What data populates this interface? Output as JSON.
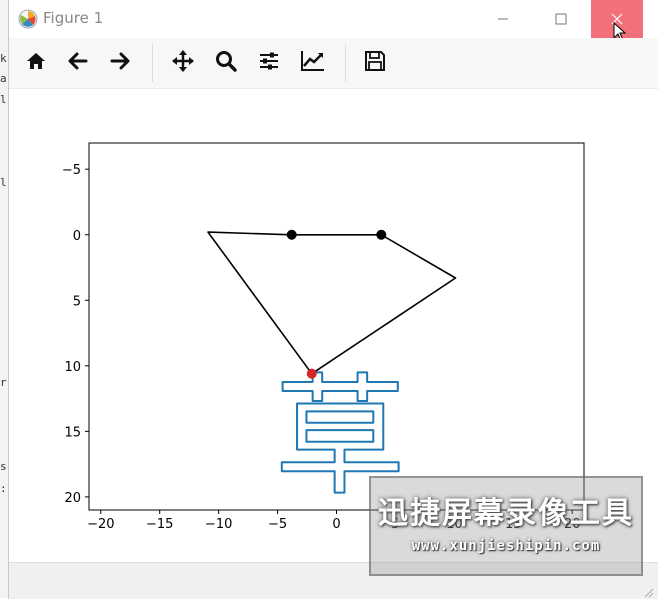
{
  "window": {
    "title": "Figure 1"
  },
  "titlebar_icons": {
    "minimize": "minimize-icon",
    "maximize": "maximize-icon",
    "close": "close-icon",
    "close_color": "#f1707a"
  },
  "toolbar": {
    "buttons": [
      {
        "name": "home-button",
        "icon": "home-icon"
      },
      {
        "name": "back-button",
        "icon": "arrow-left-icon"
      },
      {
        "name": "forward-button",
        "icon": "arrow-right-icon"
      },
      {
        "name": "pan-button",
        "icon": "move-icon"
      },
      {
        "name": "zoom-button",
        "icon": "zoom-icon"
      },
      {
        "name": "configure-subplots-button",
        "icon": "sliders-icon"
      },
      {
        "name": "edit-axis-button",
        "icon": "chart-line-icon"
      },
      {
        "name": "save-button",
        "icon": "save-icon"
      }
    ]
  },
  "background_text": [
    "k",
    "a",
    "l",
    "",
    "",
    "",
    "l",
    "",
    "r",
    "",
    "",
    "",
    "",
    "",
    "r",
    "",
    "",
    "",
    "s",
    ":"
  ],
  "watermark": {
    "title": "迅捷屏幕录像工具",
    "url": "www.xunjieshipin.com"
  },
  "chart_data": {
    "type": "line",
    "title": "",
    "xlabel": "",
    "ylabel": "",
    "xlim": [
      -21,
      21
    ],
    "ylim": [
      21,
      -7
    ],
    "y_inverted": true,
    "grid": false,
    "xticks": [
      -20,
      -15,
      -10,
      -5,
      0,
      5,
      10,
      15,
      20
    ],
    "xtick_labels": [
      "−20",
      "−15",
      "−10",
      "−5",
      "0",
      "5",
      "10",
      "15",
      "20"
    ],
    "yticks": [
      -5,
      0,
      5,
      10,
      15,
      20
    ],
    "ytick_labels": [
      "−5",
      "0",
      "5",
      "10",
      "15",
      "20"
    ],
    "series": [
      {
        "kind": "polyline",
        "color": "#000000",
        "points": [
          [
            -2.1,
            10.6
          ],
          [
            10.1,
            3.3
          ],
          [
            3.8,
            0.0
          ],
          [
            -3.8,
            0.0
          ],
          [
            -10.9,
            -0.2
          ],
          [
            -2.1,
            10.6
          ]
        ]
      },
      {
        "kind": "markers",
        "color": "#000000",
        "points": [
          [
            -3.8,
            0.0
          ],
          [
            3.8,
            0.0
          ]
        ]
      },
      {
        "kind": "markers",
        "color": "#d62728",
        "points": [
          [
            -2.1,
            10.6
          ]
        ]
      },
      {
        "kind": "glyph-outline",
        "color": "#1f77b4",
        "glyph": "草",
        "center": [
          0.3,
          15.3
        ],
        "height": 10.0
      }
    ]
  }
}
